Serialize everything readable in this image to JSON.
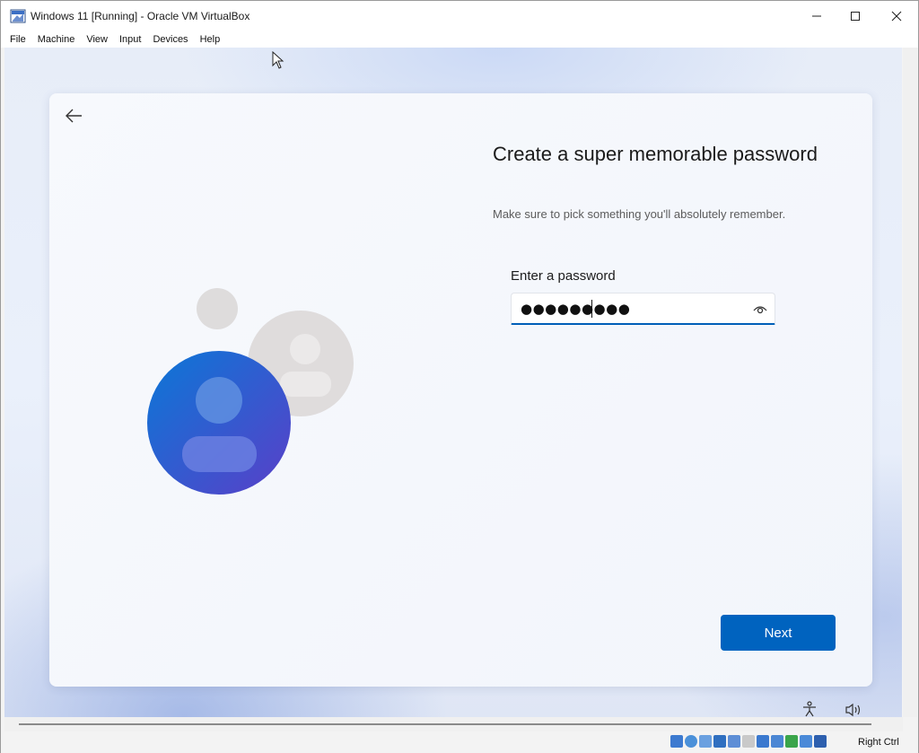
{
  "window": {
    "title": "Windows 11 [Running] - Oracle VM VirtualBox",
    "minimize_icon": "minimize-icon",
    "maximize_icon": "maximize-icon",
    "close_icon": "close-icon"
  },
  "menubar": {
    "items": [
      {
        "label": "File"
      },
      {
        "label": "Machine"
      },
      {
        "label": "View"
      },
      {
        "label": "Input"
      },
      {
        "label": "Devices"
      },
      {
        "label": "Help"
      }
    ]
  },
  "oobe": {
    "heading": "Create a super memorable password",
    "subheading": "Make sure to pick something you'll absolutely remember.",
    "password_label": "Enter a password",
    "password_value": "●●●●●●●●●",
    "next_label": "Next"
  },
  "statusbar": {
    "host_key": "Right Ctrl"
  },
  "colors": {
    "accent": "#005fb8",
    "next_button": "#0063bf"
  }
}
